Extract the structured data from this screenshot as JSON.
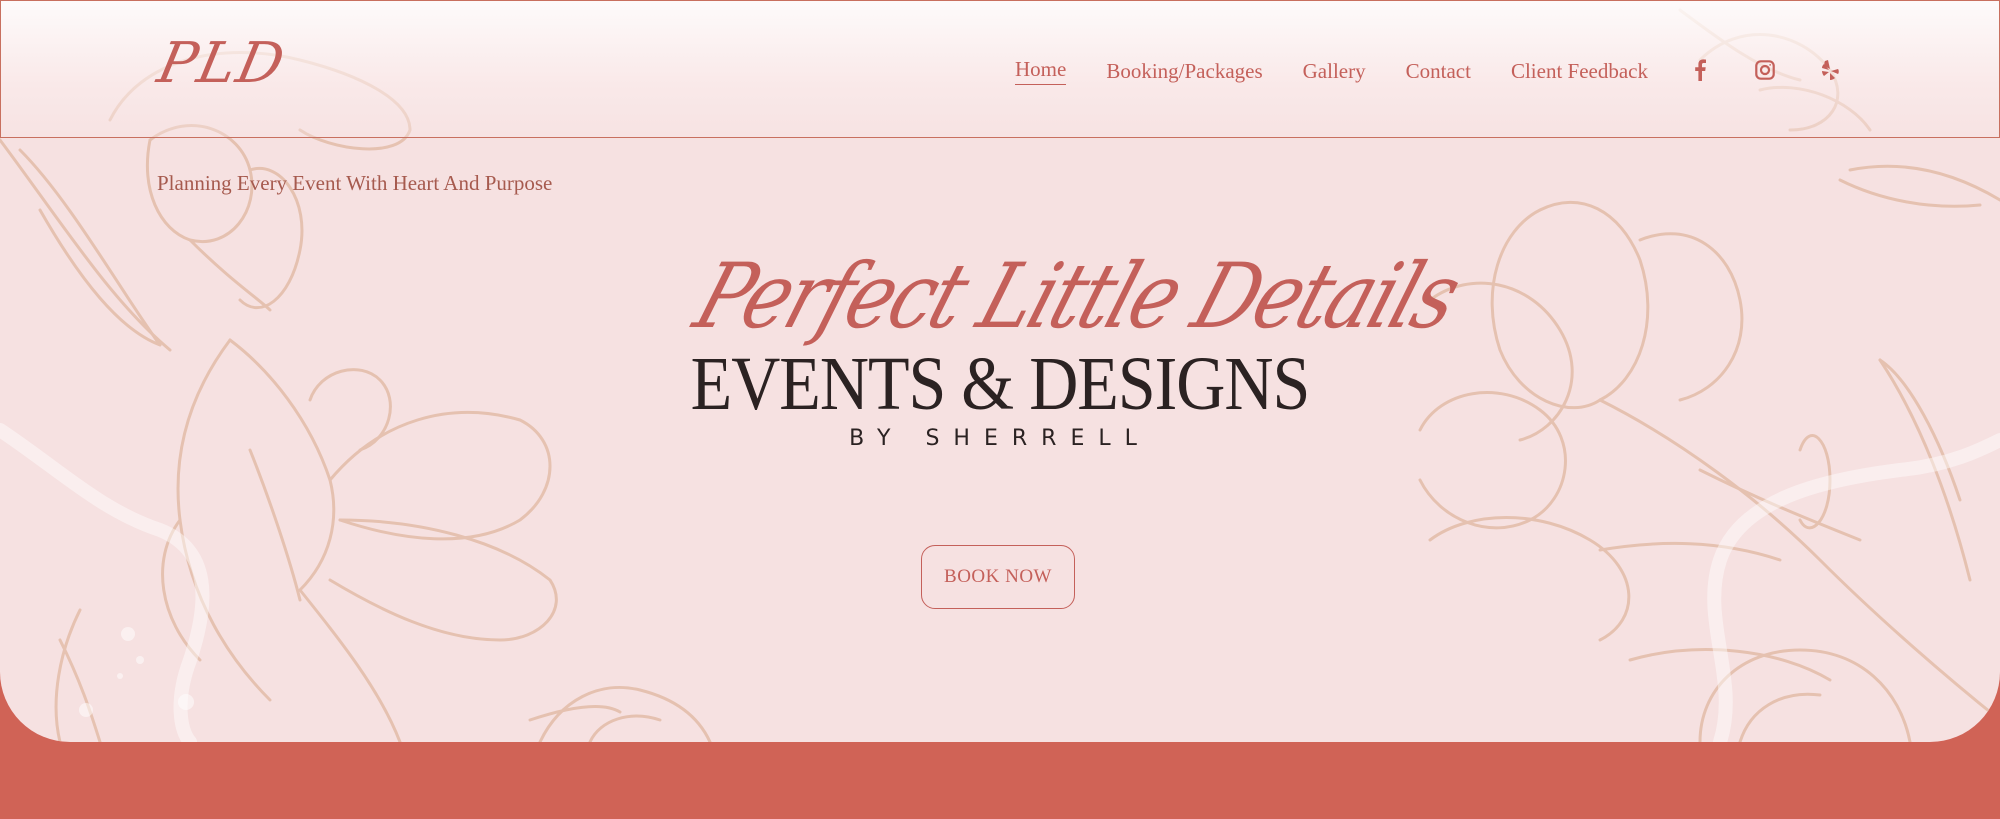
{
  "logo": {
    "text": "PLD"
  },
  "nav": {
    "items": [
      {
        "label": "Home",
        "active": true
      },
      {
        "label": "Booking/Packages",
        "active": false
      },
      {
        "label": "Gallery",
        "active": false
      },
      {
        "label": "Contact",
        "active": false
      },
      {
        "label": "Client Feedback",
        "active": false
      }
    ],
    "social": [
      "facebook-icon",
      "instagram-icon",
      "yelp-icon"
    ]
  },
  "hero": {
    "tagline": "Planning Every Event With Heart And Purpose",
    "script_title": "Perfect Little Details",
    "title": "EVENTS & DESIGNS",
    "subtitle": "BY SHERRELL",
    "cta_label": "BOOK NOW"
  },
  "colors": {
    "accent": "#c4605a",
    "hero_background": "#f6e1e1",
    "footer_band": "#d06356",
    "title_text": "#2b2222",
    "floral_line": "#dcae98"
  }
}
